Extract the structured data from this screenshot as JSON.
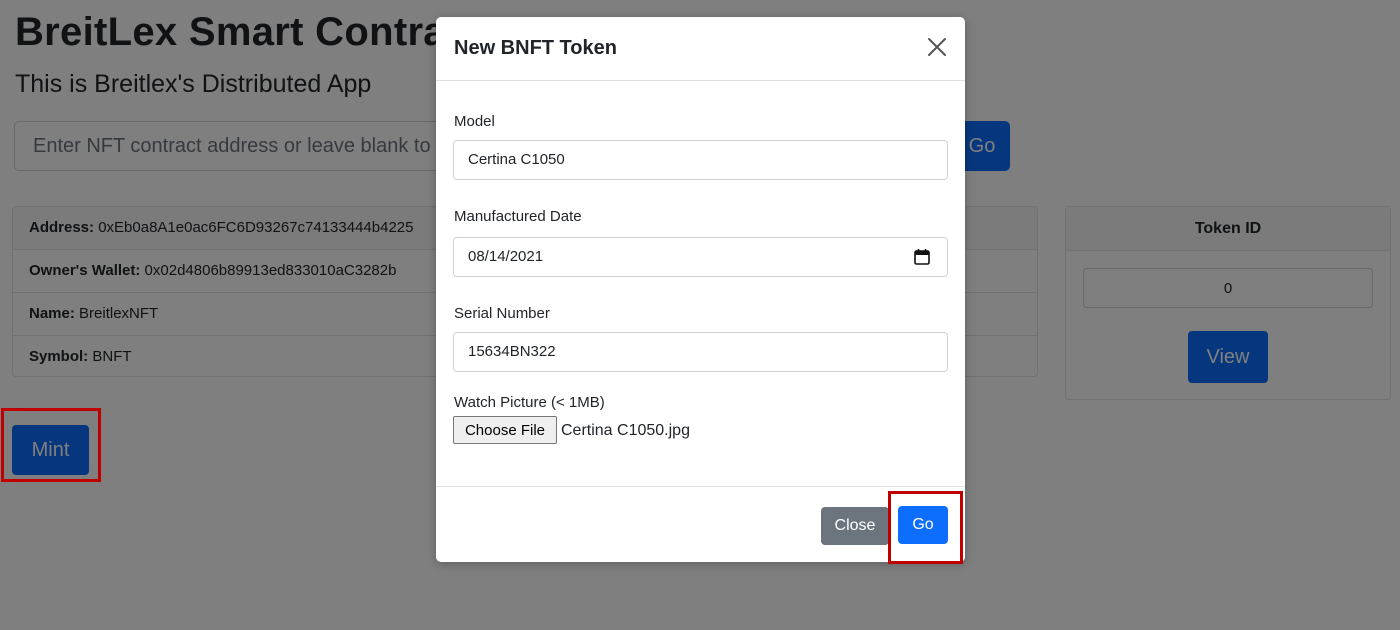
{
  "colors": {
    "primary": "#0d6efd",
    "secondary": "#6c757d",
    "highlight": "#c00000"
  },
  "page": {
    "title": "BreitLex Smart Contract",
    "subtitle": "This is Breitlex's Distributed App",
    "address_placeholder": "Enter NFT contract address or leave blank to use default",
    "lookup_button": "Go",
    "mint_button": "Mint"
  },
  "contract_info": {
    "address_label": "Address:",
    "address_value": "0xEb0a8A1e0ac6FC6D93267c74133444b4225",
    "owner_label": "Owner's Wallet:",
    "owner_value": "0x02d4806b89913ed833010aC3282b",
    "name_label": "Name:",
    "name_value": "BreitlexNFT",
    "symbol_label": "Symbol:",
    "symbol_value": "BNFT"
  },
  "token_panel": {
    "header": "Token ID",
    "token_id_value": "0",
    "view_button": "View"
  },
  "modal": {
    "title": "New BNFT Token",
    "close_icon": "close-icon",
    "model_label": "Model",
    "model_value": "Certina C1050",
    "date_label": "Manufactured Date",
    "date_value": "08/14/2021",
    "calendar_icon": "calendar-icon",
    "serial_label": "Serial Number",
    "serial_value": "15634BN322",
    "picture_label": "Watch Picture (< 1MB)",
    "choose_file_button": "Choose File",
    "file_name": "Certina C1050.jpg",
    "close_button": "Close",
    "go_button": "Go"
  }
}
